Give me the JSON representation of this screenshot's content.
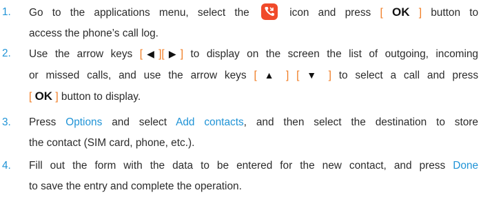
{
  "steps": [
    {
      "num": "1.",
      "l1_a": "Go to the applications menu, select the",
      "icon": "call-log-app-icon",
      "l1_b": "icon and press",
      "ok": "OK",
      "l1_c": "button to",
      "l2": "access the phone’s call log."
    },
    {
      "num": "2.",
      "l1_a": "Use the arrow keys",
      "left": "◀",
      "right": "▶",
      "l1_b": "to display on the screen the list of outgoing, incoming",
      "l2_a": "or missed calls, and use the arrow keys",
      "up": "▲",
      "down": "▼",
      "l2_b": "to select a call and press",
      "ok": "OK",
      "l3": "button to display."
    },
    {
      "num": "3.",
      "l1_a": "Press",
      "link1": "Options",
      "l1_b": "and select",
      "link2": "Add contacts",
      "l1_c": ", and then select the destination to store",
      "l2": "the contact (SIM card, phone, etc.)."
    },
    {
      "num": "4.",
      "l1_a": "Fill out the form with the data to be entered for the new contact, and press",
      "link": "Done",
      "l2": "to save the entry and complete the operation."
    }
  ],
  "colors": {
    "accent": "#1f93d6",
    "bracket": "#f07a1f",
    "icon_bg": "#f04a2a"
  }
}
